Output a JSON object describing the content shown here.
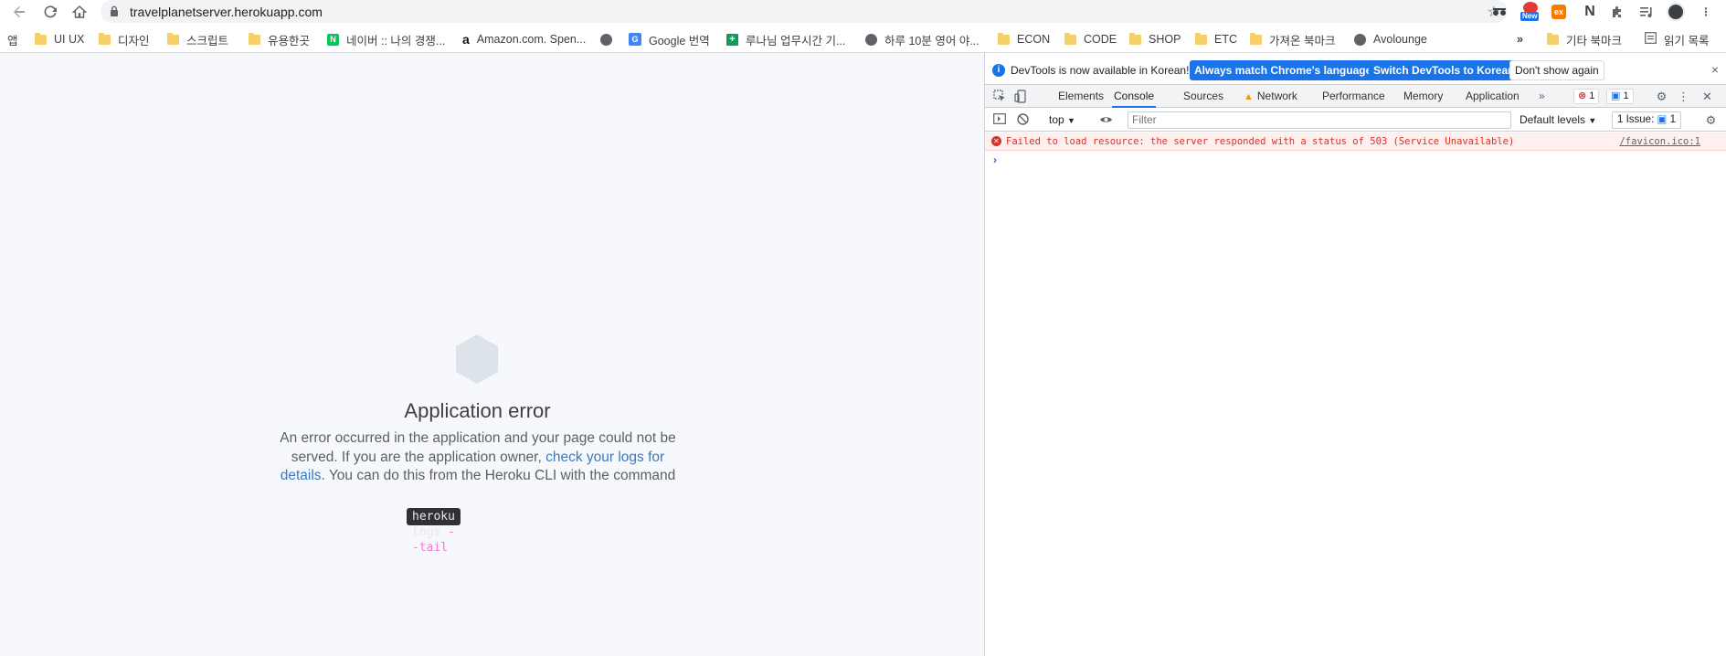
{
  "browser": {
    "url": "travelplanetserver.herokuapp.com",
    "icons": {
      "back": "back-arrow-icon",
      "reload": "reload-icon",
      "home": "home-icon",
      "lock": "lock-icon",
      "star": "star-icon"
    },
    "extensions": {
      "new_badge": "New",
      "ex_badge": "ex",
      "nn_badge": "N"
    }
  },
  "bookmarks": [
    {
      "label": "앱",
      "icon": "apps"
    },
    {
      "label": "UI UX",
      "icon": "folder"
    },
    {
      "label": "디자인",
      "icon": "folder"
    },
    {
      "label": "스크립트",
      "icon": "folder"
    },
    {
      "label": "유용한곳",
      "icon": "folder"
    },
    {
      "label": "네이버 :: 나의 경쟁...",
      "icon": "naver",
      "icon_text": "N"
    },
    {
      "label": "Amazon.com. Spen...",
      "icon": "amazon",
      "icon_text": "a"
    },
    {
      "label": "",
      "icon": "globe"
    },
    {
      "label": "Google 번역",
      "icon": "google-translate",
      "icon_text": "G"
    },
    {
      "label": "루나님 업무시간 기...",
      "icon": "google-sheets",
      "icon_text": "+"
    },
    {
      "label": "하루 10분 영어 야...",
      "icon": "globe"
    },
    {
      "label": "ECON",
      "icon": "folder"
    },
    {
      "label": "CODE",
      "icon": "folder"
    },
    {
      "label": "SHOP",
      "icon": "folder"
    },
    {
      "label": "ETC",
      "icon": "folder"
    },
    {
      "label": "가져온 북마크",
      "icon": "folder"
    },
    {
      "label": "Avolounge",
      "icon": "globe"
    }
  ],
  "bookmarks_right": {
    "more": "»",
    "other": "기타 북마크",
    "reading_list": "읽기 목록"
  },
  "error_page": {
    "title": "Application error",
    "body_before_link": "An error occurred in the application and your page could not be served. If you are the application owner, ",
    "link_text": "check your logs for details",
    "body_after_link": ". You can do this from the Heroku CLI with the command",
    "command": "heroku logs ",
    "command_flag": "--tail"
  },
  "devtools": {
    "infobar": {
      "message": "DevTools is now available in Korean!",
      "btn_match": "Always match Chrome's language",
      "btn_switch": "Switch DevTools to Korean",
      "btn_dismiss": "Don't show again",
      "close": "×"
    },
    "tabs": [
      "Elements",
      "Console",
      "Sources",
      "Network",
      "Performance",
      "Memory",
      "Application"
    ],
    "active_tab": "Console",
    "more_tabs": "»",
    "error_count": "1",
    "message_count": "1",
    "console": {
      "context": "top",
      "filter_placeholder": "Filter",
      "levels": "Default levels",
      "issues_label": "1 Issue:",
      "issues_count": "1",
      "error_message": "Failed to load resource: the server responded with a status of 503 (Service Unavailable)",
      "error_source": "/favicon.ico:1",
      "prompt": "›"
    }
  },
  "colors": {
    "chrome_blue": "#1a73e8",
    "error_red": "#d93025",
    "error_bg": "#fff0f0",
    "page_bg": "#f7f8fb",
    "link": "#3a7ac0"
  }
}
